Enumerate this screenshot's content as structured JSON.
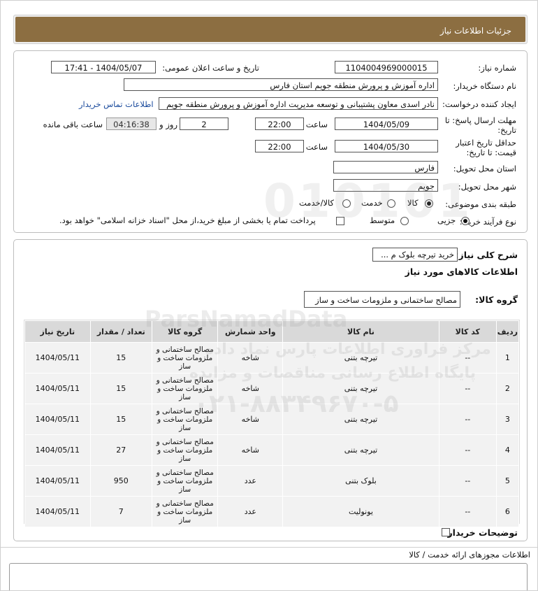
{
  "page": {
    "title": "جزئیات اطلاعات نیاز"
  },
  "info": {
    "need_number_label": "شماره نیاز:",
    "need_number": "1104004969000015",
    "announce_label": "تاریخ و ساعت اعلان عمومی:",
    "announce_value": "1404/05/07 - 17:41",
    "buyer_org_label": "نام دستگاه خریدار:",
    "buyer_org": "اداره آموزش و پرورش منطقه جویم استان فارس",
    "creator_label": "ایجاد کننده درخواست:",
    "creator": "نادر اسدی معاون پشتیبانی و توسعه مدیریت اداره آموزش و پرورش منطقه جویم",
    "contact_link": "اطلاعات تماس خریدار",
    "deadline_label_1": "مهلت ارسال پاسخ: تا",
    "deadline_label_2": "تاریخ:",
    "deadline_date": "1404/05/09",
    "time_label": "ساعت",
    "deadline_time": "22:00",
    "days": "2",
    "days_label": "روز و",
    "remaining": "04:16:38",
    "remaining_label": "ساعت باقی مانده",
    "validity_label_1": "حداقل تاریخ اعتبار",
    "validity_label_2": "قیمت: تا تاریخ:",
    "validity_date": "1404/05/30",
    "validity_time": "22:00",
    "province_label": "استان محل تحویل:",
    "province": "فارس",
    "city_label": "شهر محل تحویل:",
    "city": "جویم",
    "category_label": "طبقه بندی موضوعی:",
    "cat_goods": "کالا",
    "cat_service": "خدمت",
    "cat_both": "کالا/خدمت",
    "process_label": "نوع فرآیند خرید :",
    "proc_partial": "جزیی",
    "proc_medium": "متوسط",
    "payment_note": "پرداخت تمام یا بخشی از مبلغ خرید،از محل \"اسناد خزانه اسلامی\" خواهد بود."
  },
  "summary": {
    "desc_label": "شرح کلی نیاز:",
    "desc_value": "خرید تیرچه بلوک م ...",
    "goods_info_title": "اطلاعات کالاهای مورد نیاز",
    "group_label": "گروه کالا:",
    "group_value": "مصالح ساختمانی و ملزومات ساخت و ساز"
  },
  "table": {
    "headers": [
      "ردیف",
      "کد کالا",
      "نام کالا",
      "واحد شمارش",
      "گروه کالا",
      "تعداد / مقدار",
      "تاریخ نیاز"
    ],
    "rows": [
      {
        "idx": "1",
        "code": "--",
        "name": "تیرچه بتنی",
        "unit": "شاخه",
        "group": "مصالح ساختمانی و ملزومات ساخت و ساز",
        "qty": "15",
        "date": "1404/05/11"
      },
      {
        "idx": "2",
        "code": "--",
        "name": "تیرچه بتنی",
        "unit": "شاخه",
        "group": "مصالح ساختمانی و ملزومات ساخت و ساز",
        "qty": "15",
        "date": "1404/05/11"
      },
      {
        "idx": "3",
        "code": "--",
        "name": "تیرچه بتنی",
        "unit": "شاخه",
        "group": "مصالح ساختمانی و ملزومات ساخت و ساز",
        "qty": "15",
        "date": "1404/05/11"
      },
      {
        "idx": "4",
        "code": "--",
        "name": "تیرچه بتنی",
        "unit": "شاخه",
        "group": "مصالح ساختمانی و ملزومات ساخت و ساز",
        "qty": "27",
        "date": "1404/05/11"
      },
      {
        "idx": "5",
        "code": "--",
        "name": "بلوک بتنی",
        "unit": "عدد",
        "group": "مصالح ساختمانی و ملزومات ساخت و ساز",
        "qty": "950",
        "date": "1404/05/11"
      },
      {
        "idx": "6",
        "code": "--",
        "name": "یونولیت",
        "unit": "عدد",
        "group": "مصالح ساختمانی و ملزومات ساخت و ساز",
        "qty": "7",
        "date": "1404/05/11"
      }
    ]
  },
  "buyer_notes_label": "توضیحات خریدار:",
  "license_info": "اطلاعات مجوزهای ارائه خدمت / کالا",
  "watermark": {
    "brand": "ParsNamadData",
    "line1": "مرکز فراوری اطلاعات پارس نماد داده",
    "line2": "پایگاه اطلاع رسانی مناقصات و مزایده",
    "phone": "۰۲۱-۸۸۳۴۹۶۷۰-۵"
  }
}
